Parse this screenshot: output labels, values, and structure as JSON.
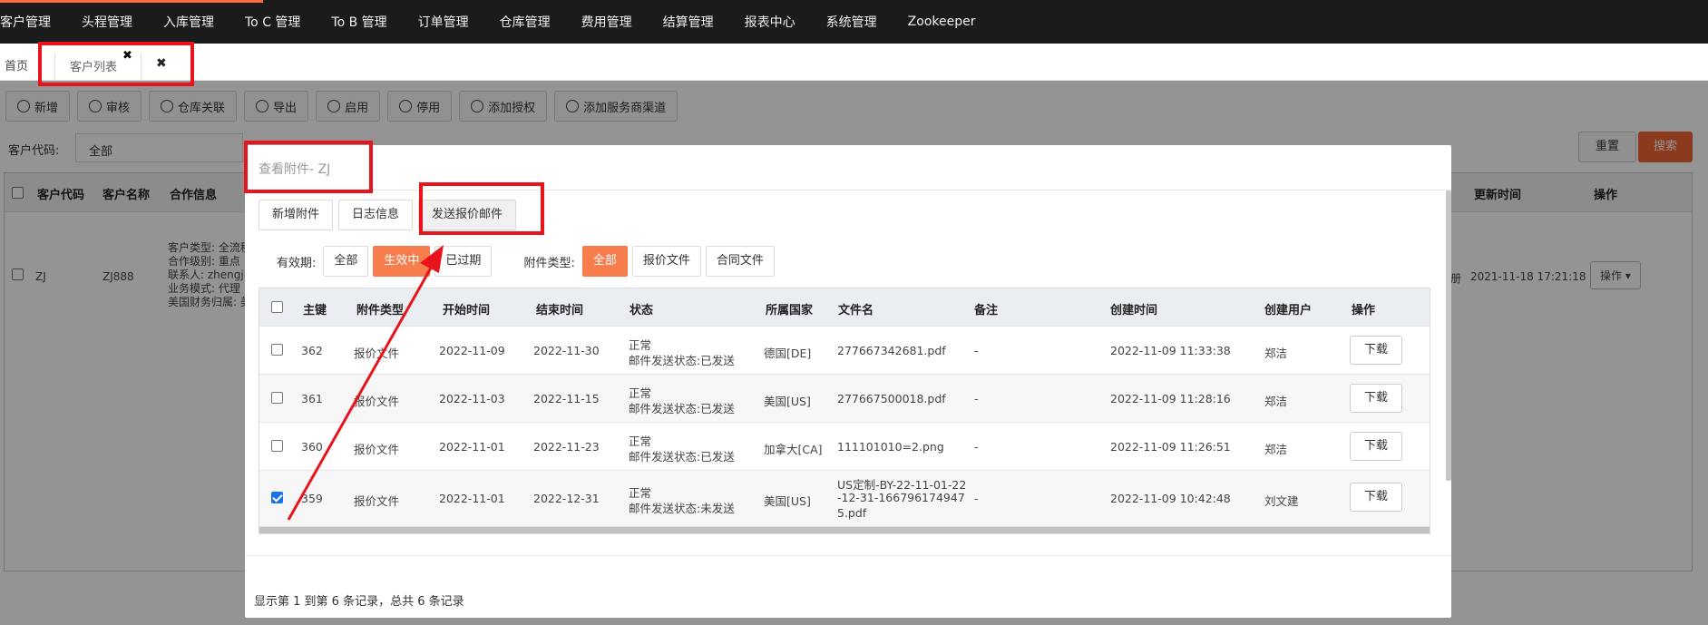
{
  "topnav": {
    "items": [
      "客户管理",
      "头程管理",
      "入库管理",
      "To C 管理",
      "To B 管理",
      "订单管理",
      "仓库管理",
      "费用管理",
      "结算管理",
      "报表中心",
      "系统管理",
      "Zookeeper"
    ]
  },
  "tabbar": {
    "home": "首页",
    "active_tab": "客户列表",
    "close_glyph": "✖"
  },
  "toolbar": {
    "buttons": [
      "新增",
      "审核",
      "仓库关联",
      "导出",
      "启用",
      "停用",
      "添加授权",
      "添加服务商渠道"
    ]
  },
  "filter": {
    "customer_code_label": "客户代码:",
    "customer_code_value": "全部",
    "reset": "重置",
    "search": "搜索"
  },
  "main_table": {
    "headers": [
      "客户代码",
      "客户名称",
      "合作信息",
      "更新时间",
      "操作"
    ],
    "row": {
      "code": "ZJ",
      "name": "ZJ888",
      "info": [
        "客户类型: 全流程",
        "合作级别: 重点",
        "联系人: zhengji",
        "业务模式: 代理",
        "美国财务归属: 美"
      ],
      "updated": "2021-11-18 17:21:18",
      "action": "操作 ▾",
      "side_char": "册"
    }
  },
  "modal": {
    "title": "查看附件- ZJ",
    "tabs": [
      "新增附件",
      "日志信息",
      "发送报价邮件"
    ],
    "validity_label": "有效期:",
    "validity_options": [
      "全部",
      "生效中",
      "已过期"
    ],
    "validity_selected": "生效中",
    "type_label": "附件类型:",
    "type_options": [
      "全部",
      "报价文件",
      "合同文件"
    ],
    "type_selected": "全部",
    "table": {
      "headers": [
        "主键",
        "附件类型",
        "开始时间",
        "结束时间",
        "状态",
        "所属国家",
        "文件名",
        "备注",
        "创建时间",
        "创建用户",
        "操作"
      ],
      "rows": [
        {
          "id": "362",
          "type": "报价文件",
          "start": "2022-11-09",
          "end": "2022-11-30",
          "status1": "正常",
          "status2": "邮件发送状态:已发送",
          "country": "德国[DE]",
          "file": "277667342681.pdf",
          "remark": "-",
          "created": "2022-11-09 11:33:38",
          "user": "郑洁",
          "action": "下载",
          "checked": false
        },
        {
          "id": "361",
          "type": "报价文件",
          "start": "2022-11-03",
          "end": "2022-11-15",
          "status1": "正常",
          "status2": "邮件发送状态:已发送",
          "country": "美国[US]",
          "file": "277667500018.pdf",
          "remark": "-",
          "created": "2022-11-09 11:28:16",
          "user": "郑洁",
          "action": "下载",
          "checked": false
        },
        {
          "id": "360",
          "type": "报价文件",
          "start": "2022-11-01",
          "end": "2022-11-23",
          "status1": "正常",
          "status2": "邮件发送状态:已发送",
          "country": "加拿大[CA]",
          "file": "111101010=2.png",
          "remark": "-",
          "created": "2022-11-09 11:26:51",
          "user": "郑洁",
          "action": "下载",
          "checked": false
        },
        {
          "id": "359",
          "type": "报价文件",
          "start": "2022-11-01",
          "end": "2022-12-31",
          "status1": "正常",
          "status2": "邮件发送状态:未发送",
          "country": "美国[US]",
          "file1": "US定制-BY-22-11-01-22",
          "file2": "-12-31-166796174947",
          "file3": "5.pdf",
          "remark": "-",
          "created": "2022-11-09 10:42:48",
          "user": "刘文建",
          "action": "下载",
          "checked": true
        }
      ]
    },
    "footer": "显示第 1 到第 6 条记录，总共 6 条记录"
  },
  "colors": {
    "accent": "#f77d4c",
    "annotation": "#e8141b",
    "nav_bg": "#1b1b1b"
  }
}
